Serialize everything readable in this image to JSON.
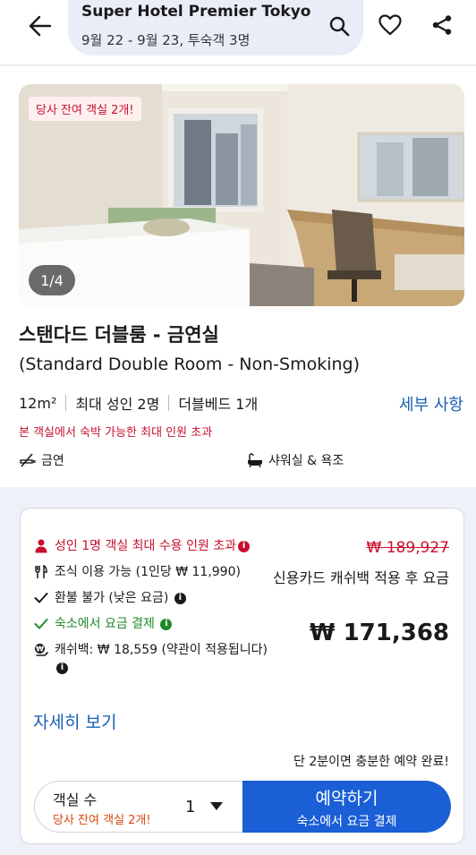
{
  "header": {
    "hotel_name": "Super Hotel Premier Tokyo ...",
    "trip_summary": "9월 22 - 9월 23, 투숙객 3명"
  },
  "room": {
    "photo_badge": "당사 잔여 객실 2개!",
    "photo_counter": "1/4",
    "name": "스탠다드 더블룸 - 금연실",
    "name_en": "(Standard Double Room - Non-Smoking)",
    "size": "12m²",
    "max_occupancy": "최대 성인 2명",
    "bed": "더블베드 1개",
    "details_link": "세부 사항",
    "occupancy_warning": "본 객실에서 숙박 가능한 최대 인원 초과",
    "amenities": [
      "금연",
      "샤워실 & 욕조"
    ]
  },
  "rate": {
    "items": [
      {
        "icon": "person-icon",
        "text": "성인 1명 객실 최대 수용 인원 초과",
        "tone": "red",
        "info": true
      },
      {
        "icon": "utensils-icon",
        "text": "조식 이용 가능 (1인당 ₩ 11,990)",
        "tone": "normal",
        "info": false
      },
      {
        "icon": "check-icon",
        "text": "환불 불가 (낮은 요금)",
        "tone": "normal",
        "info": true
      },
      {
        "icon": "check-icon",
        "text": "숙소에서 요금 결제",
        "tone": "green",
        "info": true
      },
      {
        "icon": "cashback-icon",
        "text": "캐쉬백: ₩ 18,559 (약관이 적용됩니다)",
        "tone": "normal",
        "info": true
      }
    ],
    "old_price": "₩ 189,927",
    "price_note": "신용카드 캐쉬백 적용 후 요금",
    "price": "₩ 171,368",
    "more_link": "자세히 보기",
    "quick_note": "단 2분이면 충분한 예약 완료!",
    "rooms_label": "객실 수",
    "rooms_left": "당사 잔여 객실 2개!",
    "rooms_value": "1",
    "book_label": "예약하기",
    "book_sub": "숙소에서 요금 결제"
  },
  "colors": {
    "accent_blue": "#1a5fd6",
    "link_blue": "#1a5fb4",
    "alert_red": "#c8102e",
    "success_green": "#1e8a28"
  }
}
